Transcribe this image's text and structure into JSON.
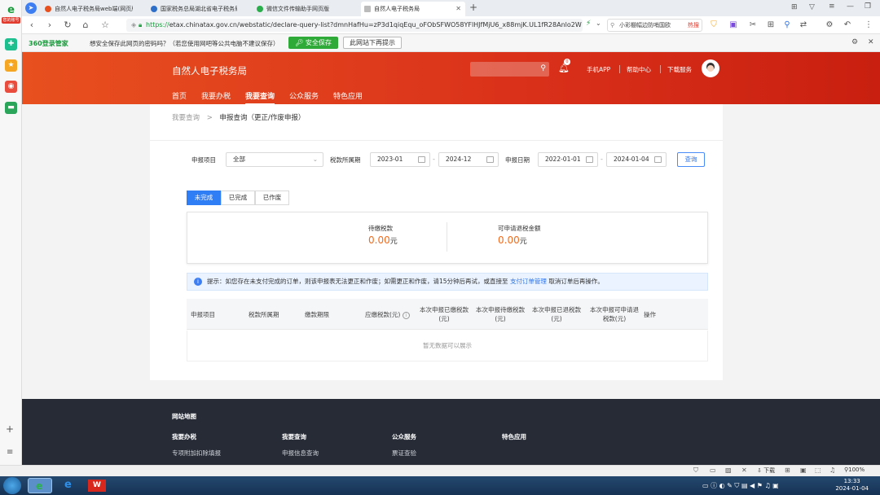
{
  "browser": {
    "leftbar_label": "您的账号",
    "tabs": [
      {
        "title": "自然人电子税务局web端(网页版"
      },
      {
        "title": "国家税务总局湖北省电子税务局"
      },
      {
        "title": "微信文件传输助手网页版"
      },
      {
        "title": "自然人电子税务局"
      }
    ],
    "url_scheme": "https://",
    "url_rest": "etax.chinatax.gov.cn/webstatic/declare-query-list?dmnHafHu=zP3d1qiqEqu_oFObSFWO58YFlHJfMjU6_x88mjK.UL1fR28Anlo2W",
    "search_text": "小彩棚幅边防哨国欧",
    "search_tag": "热搜"
  },
  "pwdbar": {
    "brand": "360登录管家",
    "message": "想安全保存此网页的密码吗？（若您使用网吧等公共电脑不建议保存）",
    "save_button": "安全保存",
    "no_prompt_button": "此网站下再提示"
  },
  "site": {
    "title": "自然人电子税务局",
    "bell_count": "0",
    "links": [
      "手机APP",
      "帮助中心",
      "下载服务"
    ],
    "nav": [
      "首页",
      "我要办税",
      "我要查询",
      "公众服务",
      "特色应用"
    ]
  },
  "breadcrumb": {
    "parent": "我要查询",
    "sep": ">",
    "current": "申报查询（更正/作废申报）"
  },
  "filters": {
    "item_label": "申报项目",
    "item_value": "全部",
    "period_label": "税款所属期",
    "period_start": "2023-01",
    "period_end": "2024-12",
    "date_label": "申报日期",
    "date_start": "2022-01-01",
    "date_end": "2024-01-04",
    "dash": "-",
    "query_button": "查询"
  },
  "status_tabs": [
    "未完成",
    "已完成",
    "已作废"
  ],
  "summary": {
    "pending_label": "待缴税款",
    "pending_value": "0.00",
    "refund_label": "可申请退税金额",
    "refund_value": "0.00",
    "unit": "元"
  },
  "tip": {
    "prefix": "提示：如您存在未支付完成的订单，则该申报表无法更正和作废；如需更正和作废，请15分钟后再试，或直接至",
    "link": "支付订单管理",
    "suffix": "取消订单后再操作。"
  },
  "table": {
    "headers": [
      "申报项目",
      "税款所属期",
      "缴款期限",
      "应缴税款(元)",
      "本次申报已缴税款(元)",
      "本次申报待缴税款(元)",
      "本次申报已退税款(元)",
      "本次申报可申请退税款(元)",
      "操作"
    ],
    "empty_text": "暂无数据可以展示"
  },
  "footer": {
    "title": "网站地图",
    "columns": [
      {
        "heading": "我要办税",
        "items": [
          "专项附加扣除填报"
        ]
      },
      {
        "heading": "我要查询",
        "items": [
          "申报信息查询"
        ]
      },
      {
        "heading": "公众服务",
        "items": [
          "票证查验"
        ]
      },
      {
        "heading": "特色应用",
        "items": []
      }
    ]
  },
  "statusbar": {
    "download": "下载",
    "zoom": "100%"
  },
  "taskbar": {
    "time": "13:33",
    "date": "2024-01-04"
  },
  "colors": {
    "header_red": "#d9301a",
    "accent_blue": "#2f7ef5",
    "amount_orange": "#f26b1d"
  }
}
